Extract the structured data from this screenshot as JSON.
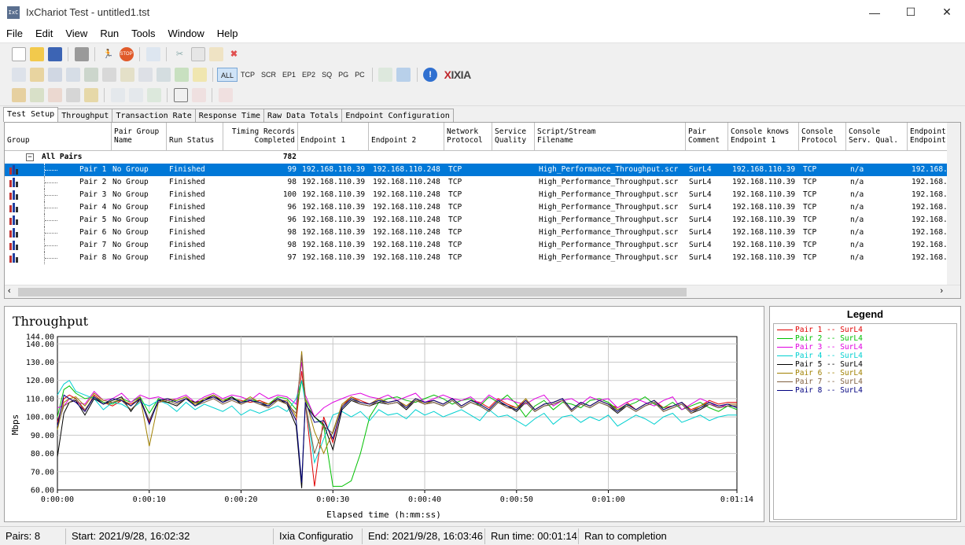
{
  "window": {
    "title": "IxChariot Test - untitled1.tst",
    "icon_text": "IxC"
  },
  "menu": [
    "File",
    "Edit",
    "View",
    "Run",
    "Tools",
    "Window",
    "Help"
  ],
  "toolbar_protocols": [
    "ALL",
    "TCP",
    "SCR",
    "EP1",
    "EP2",
    "SQ",
    "PG",
    "PC"
  ],
  "logo": {
    "x": "X",
    "rest": "IXIA"
  },
  "tabs": [
    "Test Setup",
    "Throughput",
    "Transaction Rate",
    "Response Time",
    "Raw Data Totals",
    "Endpoint Configuration"
  ],
  "grid": {
    "headers": [
      "Group",
      "Pair Group\nName",
      "Run Status",
      "Timing Records\nCompleted",
      "Endpoint 1",
      "Endpoint 2",
      "Network\nProtocol",
      "Service\nQuality",
      "Script/Stream\nFilename",
      "Pair\nComment",
      "Console knows\nEndpoint 1",
      "Console\nProtocol",
      "Console\nServ. Qual.",
      "Endpoint\nEndpoint"
    ],
    "all_pairs_label": "All Pairs",
    "all_pairs_total": "782",
    "rows": [
      {
        "pair": "Pair 1",
        "group": "No Group",
        "status": "Finished",
        "records": "99",
        "ep1": "192.168.110.39",
        "ep2": "192.168.110.248",
        "proto": "TCP",
        "sq": "",
        "script": "High_Performance_Throughput.scr",
        "comment": "SurL4",
        "ck": "192.168.110.39",
        "cp": "TCP",
        "csq": "n/a",
        "ee": "192.168."
      },
      {
        "pair": "Pair 2",
        "group": "No Group",
        "status": "Finished",
        "records": "98",
        "ep1": "192.168.110.39",
        "ep2": "192.168.110.248",
        "proto": "TCP",
        "sq": "",
        "script": "High_Performance_Throughput.scr",
        "comment": "SurL4",
        "ck": "192.168.110.39",
        "cp": "TCP",
        "csq": "n/a",
        "ee": "192.168."
      },
      {
        "pair": "Pair 3",
        "group": "No Group",
        "status": "Finished",
        "records": "100",
        "ep1": "192.168.110.39",
        "ep2": "192.168.110.248",
        "proto": "TCP",
        "sq": "",
        "script": "High_Performance_Throughput.scr",
        "comment": "SurL4",
        "ck": "192.168.110.39",
        "cp": "TCP",
        "csq": "n/a",
        "ee": "192.168."
      },
      {
        "pair": "Pair 4",
        "group": "No Group",
        "status": "Finished",
        "records": "96",
        "ep1": "192.168.110.39",
        "ep2": "192.168.110.248",
        "proto": "TCP",
        "sq": "",
        "script": "High_Performance_Throughput.scr",
        "comment": "SurL4",
        "ck": "192.168.110.39",
        "cp": "TCP",
        "csq": "n/a",
        "ee": "192.168."
      },
      {
        "pair": "Pair 5",
        "group": "No Group",
        "status": "Finished",
        "records": "96",
        "ep1": "192.168.110.39",
        "ep2": "192.168.110.248",
        "proto": "TCP",
        "sq": "",
        "script": "High_Performance_Throughput.scr",
        "comment": "SurL4",
        "ck": "192.168.110.39",
        "cp": "TCP",
        "csq": "n/a",
        "ee": "192.168."
      },
      {
        "pair": "Pair 6",
        "group": "No Group",
        "status": "Finished",
        "records": "98",
        "ep1": "192.168.110.39",
        "ep2": "192.168.110.248",
        "proto": "TCP",
        "sq": "",
        "script": "High_Performance_Throughput.scr",
        "comment": "SurL4",
        "ck": "192.168.110.39",
        "cp": "TCP",
        "csq": "n/a",
        "ee": "192.168."
      },
      {
        "pair": "Pair 7",
        "group": "No Group",
        "status": "Finished",
        "records": "98",
        "ep1": "192.168.110.39",
        "ep2": "192.168.110.248",
        "proto": "TCP",
        "sq": "",
        "script": "High_Performance_Throughput.scr",
        "comment": "SurL4",
        "ck": "192.168.110.39",
        "cp": "TCP",
        "csq": "n/a",
        "ee": "192.168."
      },
      {
        "pair": "Pair 8",
        "group": "No Group",
        "status": "Finished",
        "records": "97",
        "ep1": "192.168.110.39",
        "ep2": "192.168.110.248",
        "proto": "TCP",
        "sq": "",
        "script": "High_Performance_Throughput.scr",
        "comment": "SurL4",
        "ck": "192.168.110.39",
        "cp": "TCP",
        "csq": "n/a",
        "ee": "192.168."
      }
    ]
  },
  "chart_data": {
    "type": "line",
    "title": "Throughput",
    "xlabel": "Elapsed time (h:mm:ss)",
    "ylabel": "Mbps",
    "xlim": [
      0,
      74
    ],
    "ylim": [
      60,
      144
    ],
    "yticks": [
      "144.00",
      "140.00",
      "130.00",
      "120.00",
      "110.00",
      "100.00",
      "90.00",
      "80.00",
      "70.00",
      "60.00"
    ],
    "ytick_values": [
      144,
      140,
      130,
      120,
      110,
      100,
      90,
      80,
      70,
      60
    ],
    "xticks": [
      "0:00:00",
      "0:00:10",
      "0:00:20",
      "0:00:30",
      "0:00:40",
      "0:00:50",
      "0:01:00",
      "0:01:14"
    ],
    "xtick_values": [
      0,
      10,
      20,
      30,
      40,
      50,
      60,
      74
    ],
    "grid": true,
    "legend_position": "right panel",
    "x": [
      0,
      0.7,
      1.3,
      2,
      3,
      4,
      5,
      6,
      7,
      8,
      9,
      10,
      11,
      12,
      13,
      14,
      15,
      16,
      17,
      18,
      19,
      20,
      21,
      22,
      23,
      24,
      25,
      26,
      26.6,
      27,
      28,
      29,
      30,
      31,
      32,
      33,
      34,
      35,
      36,
      37,
      38,
      39,
      40,
      41,
      42,
      43,
      44,
      45,
      46,
      47,
      48,
      49,
      50,
      51,
      52,
      53,
      54,
      55,
      56,
      57,
      58,
      59,
      60,
      61,
      62,
      63,
      64,
      65,
      66,
      67,
      68,
      69,
      70,
      71,
      72,
      73,
      74
    ],
    "series": [
      {
        "name": "Pair 1 -- SurL4",
        "color": "#e00000",
        "values": [
          97,
          110,
          112,
          110,
          103,
          112,
          108,
          106,
          109,
          107,
          110,
          97,
          109,
          110,
          108,
          110,
          107,
          109,
          111,
          108,
          110,
          109,
          108,
          109,
          107,
          110,
          108,
          98,
          125,
          108,
          62,
          100,
          86,
          106,
          111,
          109,
          107,
          110,
          108,
          109,
          106,
          110,
          108,
          109,
          107,
          110,
          106,
          109,
          108,
          105,
          110,
          107,
          105,
          109,
          104,
          107,
          108,
          110,
          104,
          108,
          106,
          109,
          107,
          105,
          108,
          104,
          107,
          109,
          105,
          106,
          108,
          104,
          106,
          109,
          107,
          108,
          108
        ]
      },
      {
        "name": "Pair 2 -- SurL4",
        "color": "#00c000",
        "values": [
          100,
          115,
          117,
          113,
          110,
          111,
          108,
          107,
          110,
          108,
          111,
          102,
          110,
          108,
          109,
          111,
          106,
          110,
          112,
          109,
          111,
          108,
          110,
          108,
          107,
          111,
          110,
          104,
          120,
          110,
          100,
          95,
          62,
          62,
          65,
          80,
          100,
          108,
          110,
          111,
          109,
          108,
          110,
          112,
          110,
          107,
          109,
          110,
          106,
          111,
          108,
          112,
          107,
          100,
          106,
          109,
          104,
          108,
          107,
          105,
          109,
          110,
          108,
          104,
          106,
          108,
          111,
          107,
          105,
          108,
          104,
          106,
          108,
          105,
          103,
          106,
          104
        ]
      },
      {
        "name": "Pair 3 -- SurL4",
        "color": "#e000e0",
        "values": [
          105,
          106,
          110,
          108,
          107,
          114,
          109,
          110,
          113,
          108,
          112,
          110,
          111,
          109,
          110,
          112,
          108,
          111,
          113,
          110,
          112,
          111,
          109,
          113,
          110,
          112,
          111,
          107,
          130,
          112,
          100,
          105,
          108,
          110,
          112,
          113,
          111,
          110,
          112,
          109,
          111,
          113,
          108,
          110,
          112,
          110,
          109,
          111,
          107,
          112,
          109,
          110,
          108,
          107,
          110,
          112,
          106,
          109,
          110,
          107,
          111,
          109,
          110,
          105,
          108,
          110,
          108,
          106,
          109,
          111,
          104,
          107,
          110,
          108,
          105,
          107,
          107
        ]
      },
      {
        "name": "Pair 4 -- SurL4",
        "color": "#00d0d0",
        "values": [
          112,
          118,
          120,
          114,
          112,
          110,
          104,
          108,
          107,
          104,
          108,
          106,
          109,
          107,
          103,
          108,
          104,
          107,
          105,
          103,
          106,
          101,
          104,
          102,
          104,
          106,
          103,
          110,
          120,
          108,
          75,
          88,
          101,
          103,
          100,
          103,
          98,
          104,
          101,
          102,
          99,
          104,
          101,
          103,
          100,
          102,
          104,
          101,
          98,
          104,
          100,
          101,
          98,
          95,
          99,
          102,
          96,
          100,
          101,
          97,
          100,
          98,
          101,
          95,
          98,
          101,
          99,
          96,
          100,
          102,
          97,
          99,
          101,
          98,
          100,
          101,
          101
        ]
      },
      {
        "name": "Pair 5 -- SurL4",
        "color": "#000000",
        "values": [
          78,
          102,
          108,
          109,
          101,
          110,
          107,
          109,
          111,
          103,
          110,
          98,
          109,
          108,
          106,
          110,
          108,
          109,
          112,
          108,
          111,
          107,
          109,
          107,
          106,
          110,
          107,
          95,
          61,
          107,
          100,
          96,
          82,
          104,
          109,
          107,
          106,
          108,
          107,
          108,
          104,
          109,
          107,
          108,
          106,
          109,
          105,
          108,
          106,
          103,
          108,
          106,
          103,
          108,
          103,
          106,
          107,
          109,
          103,
          107,
          105,
          108,
          106,
          102,
          106,
          103,
          106,
          108,
          103,
          105,
          107,
          102,
          104,
          107,
          105,
          106,
          106
        ]
      },
      {
        "name": "Pair 6 -- SurL4",
        "color": "#a08000",
        "values": [
          93,
          108,
          110,
          111,
          106,
          113,
          109,
          108,
          110,
          106,
          111,
          84,
          108,
          110,
          109,
          111,
          107,
          110,
          112,
          109,
          110,
          108,
          111,
          108,
          107,
          109,
          109,
          100,
          136,
          110,
          92,
          80,
          92,
          107,
          111,
          108,
          107,
          110,
          108,
          109,
          106,
          110,
          107,
          109,
          107,
          110,
          106,
          109,
          107,
          104,
          109,
          106,
          105,
          110,
          104,
          107,
          108,
          110,
          104,
          108,
          106,
          109,
          107,
          104,
          107,
          104,
          107,
          109,
          104,
          106,
          108,
          103,
          106,
          108,
          106,
          107,
          107
        ]
      },
      {
        "name": "Pair 7 -- SurL4",
        "color": "#806040",
        "values": [
          95,
          106,
          108,
          110,
          104,
          111,
          107,
          108,
          109,
          104,
          109,
          98,
          108,
          109,
          107,
          110,
          106,
          108,
          110,
          107,
          109,
          107,
          109,
          107,
          105,
          109,
          107,
          102,
          134,
          108,
          80,
          95,
          91,
          106,
          110,
          107,
          106,
          109,
          107,
          108,
          105,
          109,
          107,
          108,
          106,
          109,
          105,
          108,
          106,
          103,
          108,
          105,
          104,
          108,
          103,
          106,
          107,
          109,
          103,
          107,
          105,
          108,
          106,
          103,
          106,
          103,
          106,
          108,
          103,
          105,
          107,
          102,
          105,
          107,
          105,
          106,
          106
        ]
      },
      {
        "name": "Pair 8 -- SurL4",
        "color": "#000080",
        "values": [
          95,
          112,
          110,
          108,
          103,
          111,
          107,
          110,
          109,
          106,
          110,
          96,
          109,
          110,
          108,
          110,
          106,
          109,
          111,
          108,
          110,
          108,
          109,
          108,
          106,
          110,
          108,
          98,
          64,
          108,
          97,
          98,
          88,
          105,
          110,
          108,
          107,
          109,
          108,
          109,
          105,
          110,
          108,
          109,
          107,
          110,
          106,
          109,
          107,
          104,
          109,
          106,
          104,
          109,
          104,
          107,
          108,
          110,
          104,
          108,
          106,
          109,
          107,
          103,
          107,
          104,
          107,
          109,
          104,
          106,
          108,
          103,
          105,
          108,
          106,
          107,
          105
        ]
      }
    ]
  },
  "legend": {
    "title": "Legend"
  },
  "status": {
    "pairs": "Pairs: 8",
    "start": "Start: 2021/9/28, 16:02:32",
    "config": "Ixia Configuratio",
    "end": "End: 2021/9/28, 16:03:46",
    "runtime": "Run time: 00:01:14",
    "result": "Ran to completion"
  }
}
